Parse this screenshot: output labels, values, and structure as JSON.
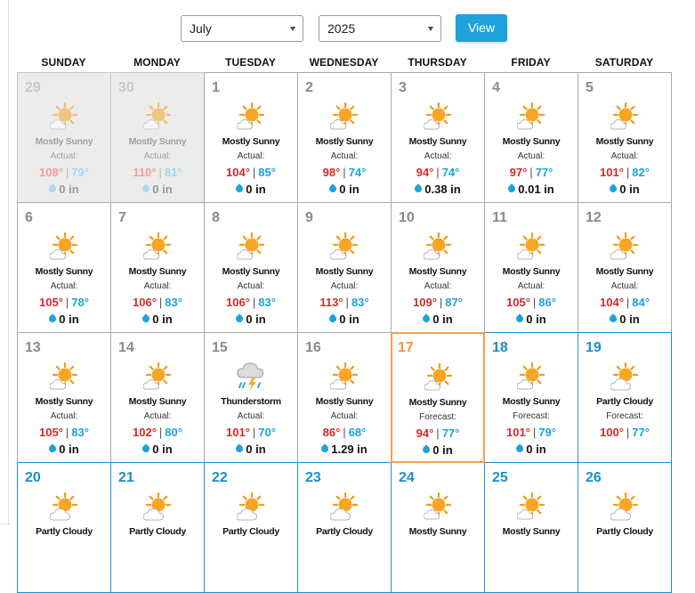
{
  "controls": {
    "month": "July",
    "year": "2025",
    "view_label": "View"
  },
  "weekdays": [
    "SUNDAY",
    "MONDAY",
    "TUESDAY",
    "WEDNESDAY",
    "THURSDAY",
    "FRIDAY",
    "SATURDAY"
  ],
  "days": [
    {
      "day": "29",
      "state": "outside",
      "icon": "mostly-sunny",
      "condition": "Mostly Sunny",
      "kind": "Actual:",
      "hi": "108°",
      "lo": "79°",
      "precip": "0 in"
    },
    {
      "day": "30",
      "state": "outside",
      "icon": "mostly-sunny",
      "condition": "Mostly Sunny",
      "kind": "Actual:",
      "hi": "110°",
      "lo": "81°",
      "precip": "0 in"
    },
    {
      "day": "1",
      "state": "past",
      "icon": "mostly-sunny",
      "condition": "Mostly Sunny",
      "kind": "Actual:",
      "hi": "104°",
      "lo": "85°",
      "precip": "0 in"
    },
    {
      "day": "2",
      "state": "past",
      "icon": "mostly-sunny",
      "condition": "Mostly Sunny",
      "kind": "Actual:",
      "hi": "98°",
      "lo": "74°",
      "precip": "0 in"
    },
    {
      "day": "3",
      "state": "past",
      "icon": "mostly-sunny",
      "condition": "Mostly Sunny",
      "kind": "Actual:",
      "hi": "94°",
      "lo": "74°",
      "precip": "0.38 in"
    },
    {
      "day": "4",
      "state": "past",
      "icon": "mostly-sunny",
      "condition": "Mostly Sunny",
      "kind": "Actual:",
      "hi": "97°",
      "lo": "77°",
      "precip": "0.01 in"
    },
    {
      "day": "5",
      "state": "past",
      "icon": "mostly-sunny",
      "condition": "Mostly Sunny",
      "kind": "Actual:",
      "hi": "101°",
      "lo": "82°",
      "precip": "0 in"
    },
    {
      "day": "6",
      "state": "past",
      "icon": "mostly-sunny",
      "condition": "Mostly Sunny",
      "kind": "Actual:",
      "hi": "105°",
      "lo": "78°",
      "precip": "0 in"
    },
    {
      "day": "7",
      "state": "past",
      "icon": "mostly-sunny",
      "condition": "Mostly Sunny",
      "kind": "Actual:",
      "hi": "106°",
      "lo": "83°",
      "precip": "0 in"
    },
    {
      "day": "8",
      "state": "past",
      "icon": "mostly-sunny",
      "condition": "Mostly Sunny",
      "kind": "Actual:",
      "hi": "106°",
      "lo": "83°",
      "precip": "0 in"
    },
    {
      "day": "9",
      "state": "past",
      "icon": "mostly-sunny",
      "condition": "Mostly Sunny",
      "kind": "Actual:",
      "hi": "113°",
      "lo": "83°",
      "precip": "0 in"
    },
    {
      "day": "10",
      "state": "past",
      "icon": "mostly-sunny",
      "condition": "Mostly Sunny",
      "kind": "Actual:",
      "hi": "109°",
      "lo": "87°",
      "precip": "0 in"
    },
    {
      "day": "11",
      "state": "past",
      "icon": "mostly-sunny",
      "condition": "Mostly Sunny",
      "kind": "Actual:",
      "hi": "105°",
      "lo": "86°",
      "precip": "0 in"
    },
    {
      "day": "12",
      "state": "past",
      "icon": "mostly-sunny",
      "condition": "Mostly Sunny",
      "kind": "Actual:",
      "hi": "104°",
      "lo": "84°",
      "precip": "0 in"
    },
    {
      "day": "13",
      "state": "past",
      "icon": "mostly-sunny",
      "condition": "Mostly Sunny",
      "kind": "Actual:",
      "hi": "105°",
      "lo": "83°",
      "precip": "0 in"
    },
    {
      "day": "14",
      "state": "past",
      "icon": "mostly-sunny",
      "condition": "Mostly Sunny",
      "kind": "Actual:",
      "hi": "102°",
      "lo": "80°",
      "precip": "0 in"
    },
    {
      "day": "15",
      "state": "past",
      "icon": "thunderstorm",
      "condition": "Thunderstorm",
      "kind": "Actual:",
      "hi": "101°",
      "lo": "70°",
      "precip": "0 in"
    },
    {
      "day": "16",
      "state": "past",
      "icon": "mostly-sunny",
      "condition": "Mostly Sunny",
      "kind": "Actual:",
      "hi": "86°",
      "lo": "68°",
      "precip": "1.29 in"
    },
    {
      "day": "17",
      "state": "today",
      "icon": "mostly-sunny",
      "condition": "Mostly Sunny",
      "kind": "Forecast:",
      "hi": "94°",
      "lo": "77°",
      "precip": "0 in"
    },
    {
      "day": "18",
      "state": "future",
      "icon": "mostly-sunny",
      "condition": "Mostly Sunny",
      "kind": "Forecast:",
      "hi": "101°",
      "lo": "79°",
      "precip": "0 in"
    },
    {
      "day": "19",
      "state": "future",
      "icon": "partly-cloudy",
      "condition": "Partly Cloudy",
      "kind": "Forecast:",
      "hi": "100°",
      "lo": "77°",
      "precip": ""
    },
    {
      "day": "20",
      "state": "future",
      "icon": "partly-cloudy",
      "condition": "Partly Cloudy",
      "kind": "",
      "hi": "",
      "lo": "",
      "precip": ""
    },
    {
      "day": "21",
      "state": "future",
      "icon": "partly-cloudy",
      "condition": "Partly Cloudy",
      "kind": "",
      "hi": "",
      "lo": "",
      "precip": ""
    },
    {
      "day": "22",
      "state": "future",
      "icon": "partly-cloudy",
      "condition": "Partly Cloudy",
      "kind": "",
      "hi": "",
      "lo": "",
      "precip": ""
    },
    {
      "day": "23",
      "state": "future",
      "icon": "partly-cloudy",
      "condition": "Partly Cloudy",
      "kind": "",
      "hi": "",
      "lo": "",
      "precip": ""
    },
    {
      "day": "24",
      "state": "future",
      "icon": "mostly-sunny",
      "condition": "Mostly Sunny",
      "kind": "",
      "hi": "",
      "lo": "",
      "precip": ""
    },
    {
      "day": "25",
      "state": "future",
      "icon": "mostly-sunny",
      "condition": "Mostly Sunny",
      "kind": "",
      "hi": "",
      "lo": "",
      "precip": ""
    },
    {
      "day": "26",
      "state": "future",
      "icon": "partly-cloudy",
      "condition": "Partly Cloudy",
      "kind": "",
      "hi": "",
      "lo": "",
      "precip": ""
    }
  ],
  "colors": {
    "accent": "#1ea2dc",
    "high_temp": "#d22a2a",
    "low_temp": "#1ba3db",
    "today_border": "#f2a152",
    "forecast_border": "#1f91c8"
  }
}
